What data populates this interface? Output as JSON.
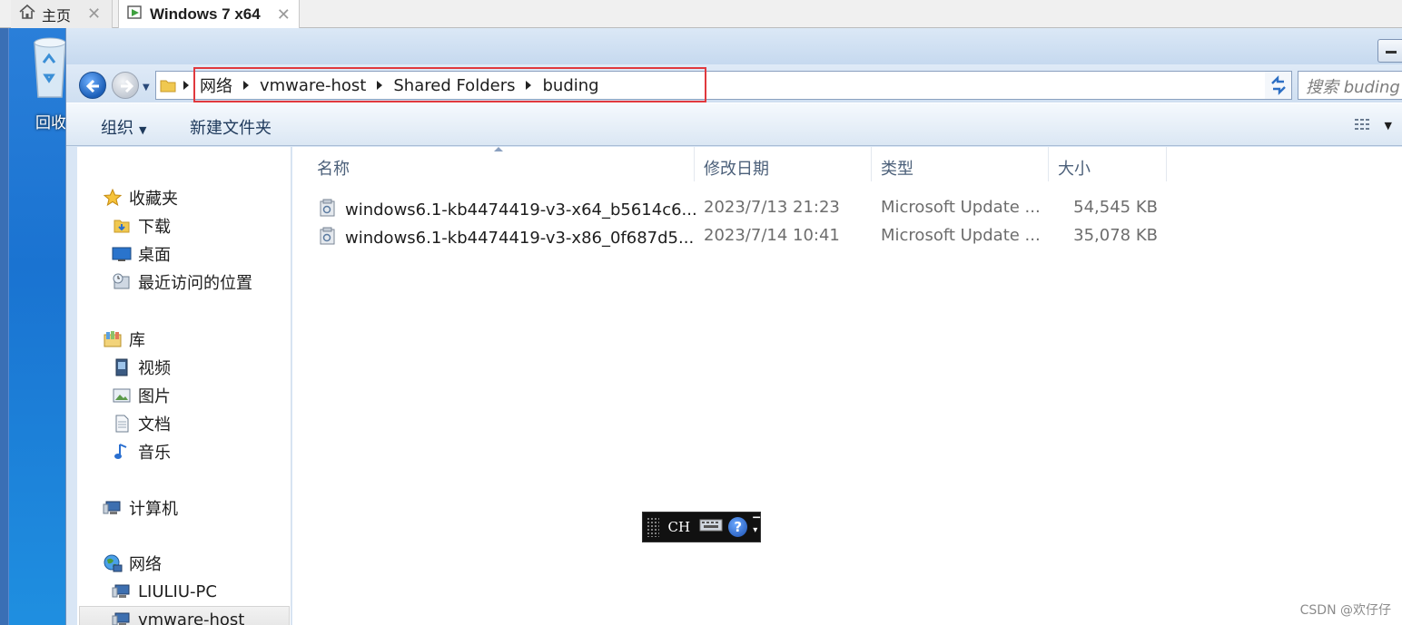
{
  "vmware_tabs": [
    {
      "label": "主页",
      "active": false
    },
    {
      "label": "Windows 7 x64",
      "active": true
    }
  ],
  "desktop": {
    "recycle_bin_label": "回收"
  },
  "address_bar": {
    "crumbs": [
      "网络",
      "vmware-host",
      "Shared Folders",
      "buding"
    ],
    "search_placeholder": "搜索 buding"
  },
  "toolbar": {
    "organize": "组织",
    "new_folder": "新建文件夹"
  },
  "nav_pane": {
    "favorites": {
      "label": "收藏夹",
      "items": [
        "下载",
        "桌面",
        "最近访问的位置"
      ]
    },
    "libraries": {
      "label": "库",
      "items": [
        "视频",
        "图片",
        "文档",
        "音乐"
      ]
    },
    "computer": {
      "label": "计算机"
    },
    "network": {
      "label": "网络",
      "items": [
        "LIULIU-PC",
        "vmware-host"
      ],
      "selected": "vmware-host"
    }
  },
  "columns": {
    "name": "名称",
    "date": "修改日期",
    "type": "类型",
    "size": "大小"
  },
  "files": [
    {
      "name": "windows6.1-kb4474419-v3-x64_b5614c6...",
      "date": "2023/7/13 21:23",
      "type": "Microsoft Update ...",
      "size": "54,545 KB"
    },
    {
      "name": "windows6.1-kb4474419-v3-x86_0f687d5...",
      "date": "2023/7/14 10:41",
      "type": "Microsoft Update ...",
      "size": "35,078 KB"
    }
  ],
  "language_bar": {
    "lang": "CH"
  },
  "watermark": "CSDN @欢仔仔",
  "colors": {
    "highlight_box": "#e0393e",
    "back_button": "#1c5fb8"
  }
}
